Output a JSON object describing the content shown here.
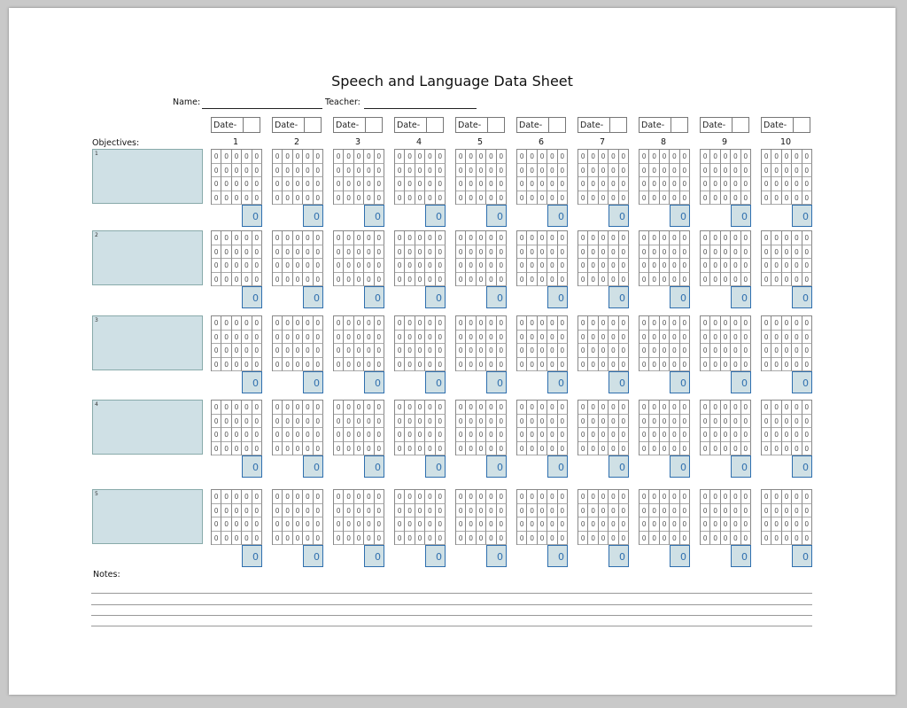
{
  "title": "Speech and Language Data Sheet",
  "name_label": "Name:",
  "teacher_label": "Teacher:",
  "objectives_label": "Objectives:",
  "date_label": "Date-",
  "notes_label": "Notes:",
  "columns": [
    "1",
    "2",
    "3",
    "4",
    "5",
    "6",
    "7",
    "8",
    "9",
    "10"
  ],
  "objectives": [
    "1",
    "2",
    "3",
    "4",
    "5"
  ],
  "cell_value": "0",
  "total_value": "0",
  "colors": {
    "accent": "#2f6fae",
    "fill": "#cfe0e5"
  }
}
